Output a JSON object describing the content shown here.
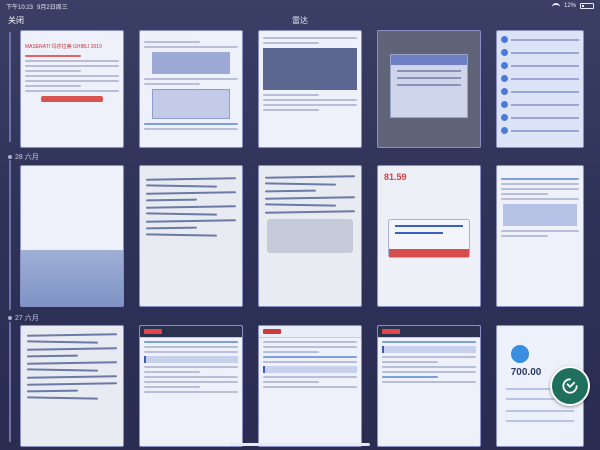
{
  "status_bar": {
    "time": "下午10:23",
    "date": "9月2日周三",
    "battery": "12%"
  },
  "nav": {
    "close_label": "关闭",
    "title": "雷达"
  },
  "sections": [
    {
      "date_label": ""
    },
    {
      "date_label": "28 六月"
    },
    {
      "date_label": "27 六月"
    }
  ],
  "thumbs": {
    "t1_heading": "MASERATI 玛莎拉蒂 GHIBLI 2019",
    "stock_price": "81.59",
    "pay_amount": "700.00"
  },
  "fab": {
    "icon": "refresh-icon"
  }
}
